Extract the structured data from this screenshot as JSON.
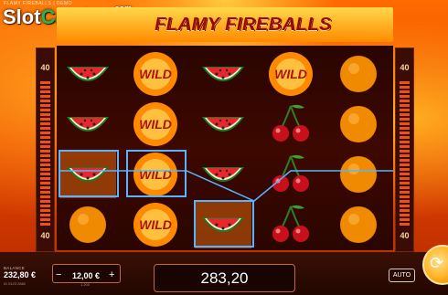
{
  "header": {
    "game_line": "FLAMY FIREBALLS | DEMO",
    "title": "FLAMY FIREBALLS",
    "watermark": {
      "slot": "Slot",
      "catalog": "Catalog",
      "com": ".com"
    }
  },
  "side_indicators": {
    "left_top": "40",
    "left_bottom": "40",
    "right_top": "40",
    "right_bottom": "40"
  },
  "reels": {
    "columns": 5,
    "rows": 4,
    "grid": [
      [
        "watermelon",
        "wild",
        "watermelon",
        "wild",
        "orange"
      ],
      [
        "watermelon",
        "wild",
        "watermelon",
        "cherry",
        "orange"
      ],
      [
        "watermelon",
        "wild",
        "watermelon",
        "cherry",
        "orange"
      ],
      [
        "orange",
        "wild",
        "watermelon",
        "cherry",
        "orange"
      ]
    ],
    "wild_label": "WILD",
    "winning_cells": [
      "r2c0",
      "r2c1",
      "r3c2"
    ]
  },
  "bottom_bar": {
    "balance_label": "BALANCE",
    "balance_value": "232,80 €",
    "balance_note": "ID 0123 2882",
    "bet_label": "BET",
    "bet_value": "12,00 €",
    "bet_minus": "−",
    "bet_plus": "+",
    "bet_note": "1.200",
    "win_value": "283,20",
    "auto_label": "AUTO"
  },
  "colors": {
    "highlight": "#58b4ff",
    "win_frame": "#c06a30",
    "title_text": "#9b0a00"
  }
}
